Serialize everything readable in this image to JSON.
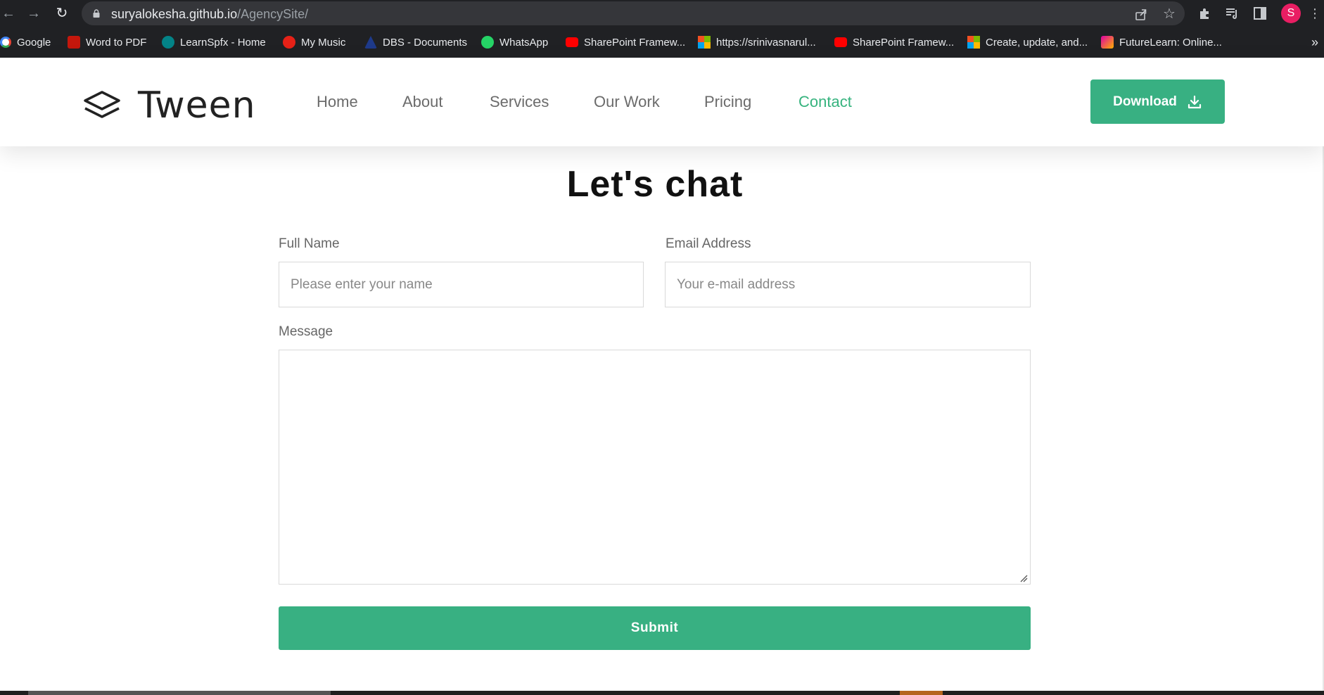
{
  "browser": {
    "url_domain": "suryalokesha.github.io",
    "url_path": "/AgencySite/",
    "profile_initial": "S",
    "bookmarks": [
      {
        "label": "Google",
        "icon": "google-icon",
        "color": "#4285f4"
      },
      {
        "label": "Word to PDF",
        "icon": "pdf-icon",
        "color": "#c4170c"
      },
      {
        "label": "LearnSpfx - Home",
        "icon": "sharepoint-icon",
        "color": "#038387"
      },
      {
        "label": "My Music",
        "icon": "music-icon",
        "color": "#e62117"
      },
      {
        "label": "DBS - Documents",
        "icon": "dbs-icon",
        "color": "#1e3a8a"
      },
      {
        "label": "WhatsApp",
        "icon": "whatsapp-icon",
        "color": "#25d366"
      },
      {
        "label": "SharePoint Framew...",
        "icon": "youtube-icon",
        "color": "#ff0000"
      },
      {
        "label": "https://srinivasnarul...",
        "icon": "microsoft-icon",
        "color": "#f25022"
      },
      {
        "label": "SharePoint Framew...",
        "icon": "youtube-icon",
        "color": "#ff0000"
      },
      {
        "label": "Create, update, and...",
        "icon": "microsoft-icon",
        "color": "#f25022"
      },
      {
        "label": "FutureLearn: Online...",
        "icon": "futurelearn-icon",
        "color": "#de00a5"
      }
    ],
    "more_bookmarks": "»"
  },
  "header": {
    "brand": "Tween",
    "nav": [
      {
        "label": "Home",
        "active": false
      },
      {
        "label": "About",
        "active": false
      },
      {
        "label": "Services",
        "active": false
      },
      {
        "label": "Our Work",
        "active": false
      },
      {
        "label": "Pricing",
        "active": false
      },
      {
        "label": "Contact",
        "active": true
      }
    ],
    "download_label": "Download"
  },
  "contact": {
    "title": "Let's chat",
    "name_label": "Full Name",
    "name_placeholder": "Please enter your name",
    "email_label": "Email Address",
    "email_placeholder": "Your e-mail address",
    "message_label": "Message",
    "message_value": "",
    "submit_label": "Submit"
  },
  "colors": {
    "accent": "#38b082",
    "nav_active": "#36b37e",
    "browser_chrome": "#202124"
  }
}
